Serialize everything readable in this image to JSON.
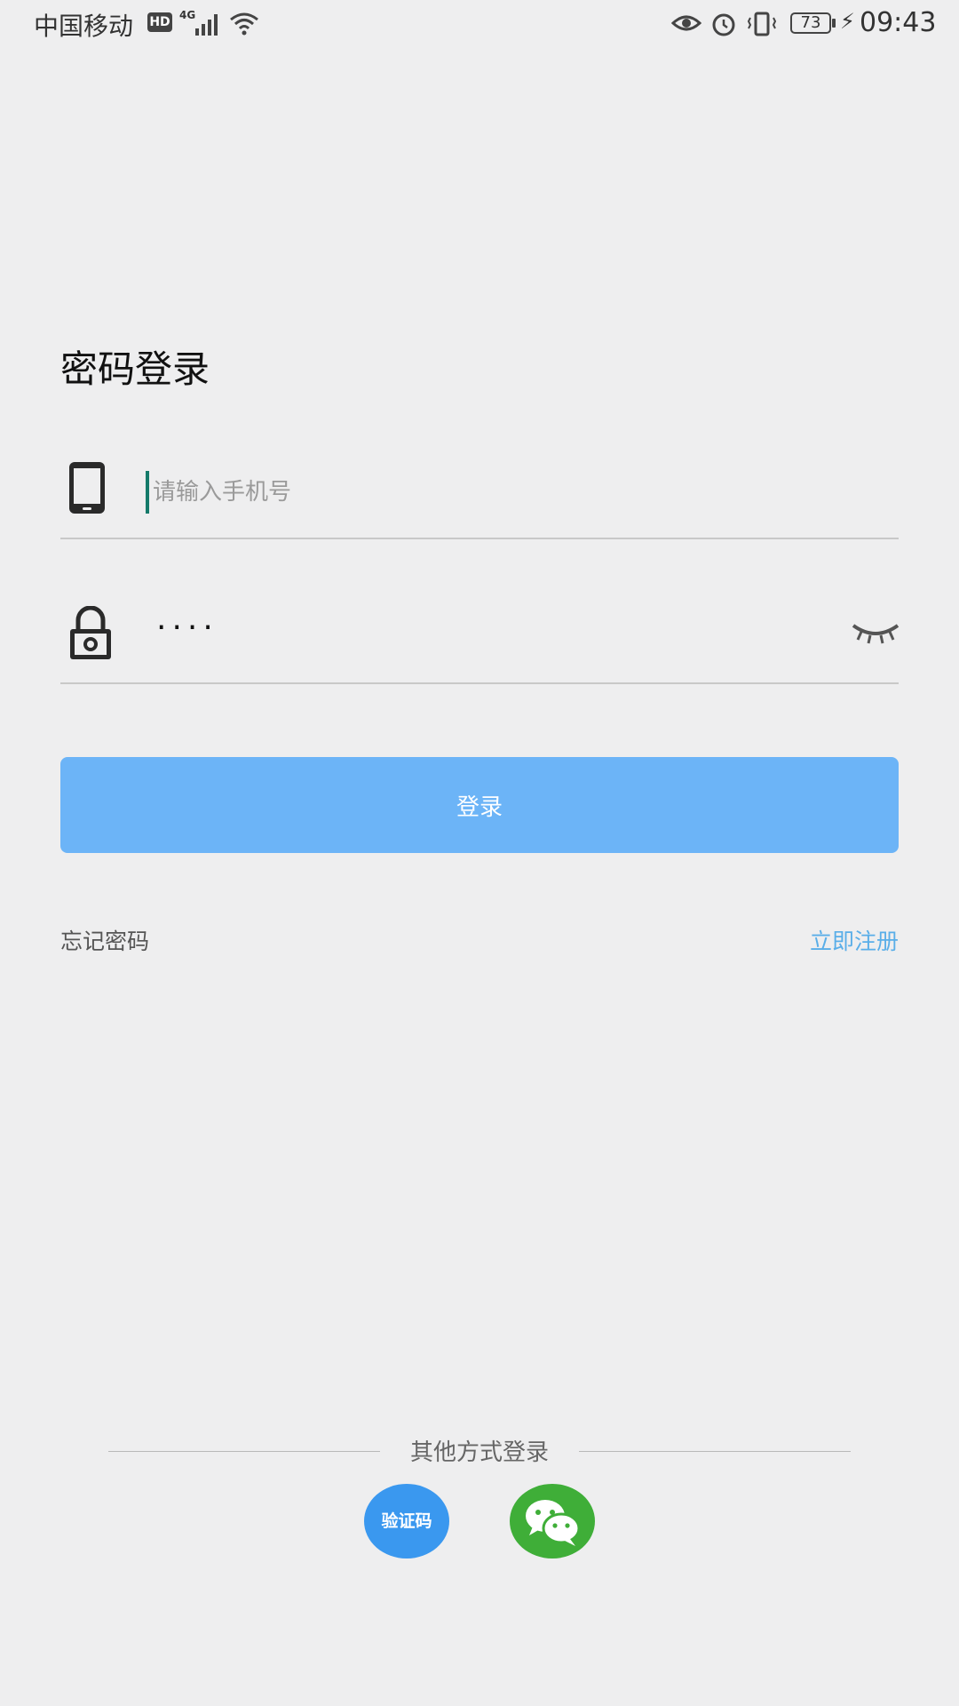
{
  "status_bar": {
    "carrier": "中国移动",
    "hd": "HD",
    "network": "4G",
    "battery": "73",
    "time": "09:43"
  },
  "title": "密码登录",
  "phone_field": {
    "placeholder": "请输入手机号",
    "value": ""
  },
  "password_field": {
    "value": "····"
  },
  "login_button": "登录",
  "forgot_password": "忘记密码",
  "register": "立即注册",
  "other_login": {
    "label": "其他方式登录",
    "sms_button": "验证码",
    "wechat_icon": "wechat-icon"
  },
  "colors": {
    "primary": "#6cb4f7",
    "link": "#5aaee8",
    "sms": "#3a98ef",
    "wechat": "#3fae38"
  }
}
